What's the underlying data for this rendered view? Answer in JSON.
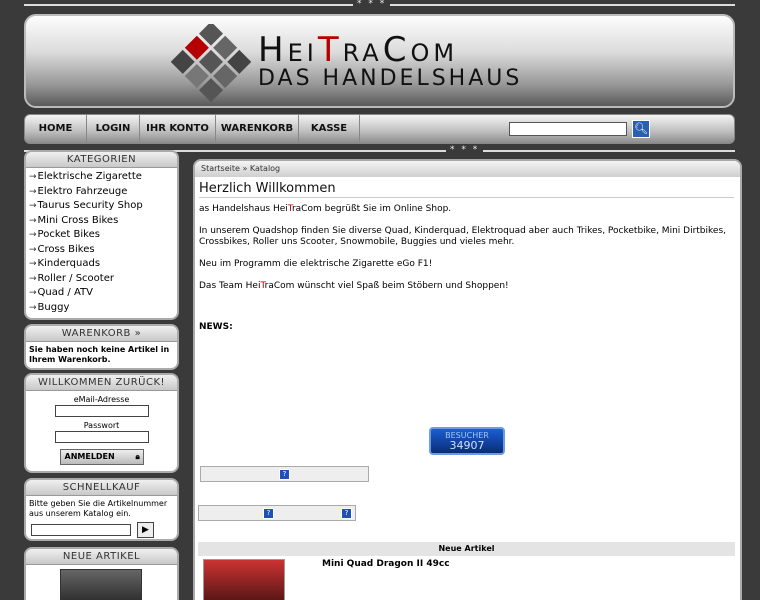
{
  "decor": {
    "stars": "* * *"
  },
  "header": {
    "brand_pre": "Hei",
    "brand_red": "T",
    "brand_post": "raCom",
    "tagline": "DAS HANDELSHAUS"
  },
  "nav": {
    "items": [
      "HOME",
      "LOGIN",
      "IHR KONTO",
      "WARENKORB",
      "KASSE"
    ]
  },
  "sidebar": {
    "categories": {
      "title": "KATEGORIEN",
      "items": [
        "Elektrische Zigarette",
        "Elektro Fahrzeuge",
        "Taurus Security Shop",
        "Mini Cross Bikes",
        "Pocket Bikes",
        "Cross Bikes",
        "Kinderquads",
        "Roller / Scooter",
        "Quad / ATV",
        "Buggy"
      ]
    },
    "cart": {
      "title": "WARENKORB »",
      "text": "Sie haben noch keine Artikel in Ihrem Warenkorb."
    },
    "login": {
      "title": "WILLKOMMEN ZURÜCK!",
      "email_label": "eMail-Adresse",
      "password_label": "Passwort",
      "button": "ANMELDEN"
    },
    "quickbuy": {
      "title": "SCHNELLKAUF",
      "text": "Bitte geben Sie die Artikelnummer aus unserem Katalog ein.",
      "button": "▶"
    },
    "new_items": {
      "title": "NEUE ARTIKEL"
    }
  },
  "main": {
    "breadcrumb": "Startseite » Katalog",
    "title": "Herzlich Willkommen",
    "p1_pre": "as Handelshaus ",
    "p1_brand_pre": "Hei",
    "p1_brand_red": "T",
    "p1_brand_post": "raCom",
    "p1_post": " begrüßt Sie im Online Shop.",
    "p2": "In unserem Quadshop finden Sie diverse Quad, Kinderquad, Elektroquad aber auch Trikes, Pocketbike,  Mini Dirtbikes, Crossbikes, Roller uns Scooter, Snowmobile, Buggies und vieles mehr.",
    "p3": "Neu im Programm die elektrische Zigarette eGo F1!",
    "p4_pre": "Das Team Hei",
    "p4_red": "T",
    "p4_post": "raCom wünscht viel Spaß beim Stöbern und Shoppen!",
    "news_label": "NEWS:",
    "counter_label": "BESUCHER",
    "counter_value": "34907",
    "help_icon": "?",
    "new_articles_header": "Neue Artikel",
    "product_name": "Mini Quad Dragon II 49cc"
  },
  "icons": {
    "search": "search-icon",
    "cart": "cart-icon",
    "arrow": "→"
  }
}
